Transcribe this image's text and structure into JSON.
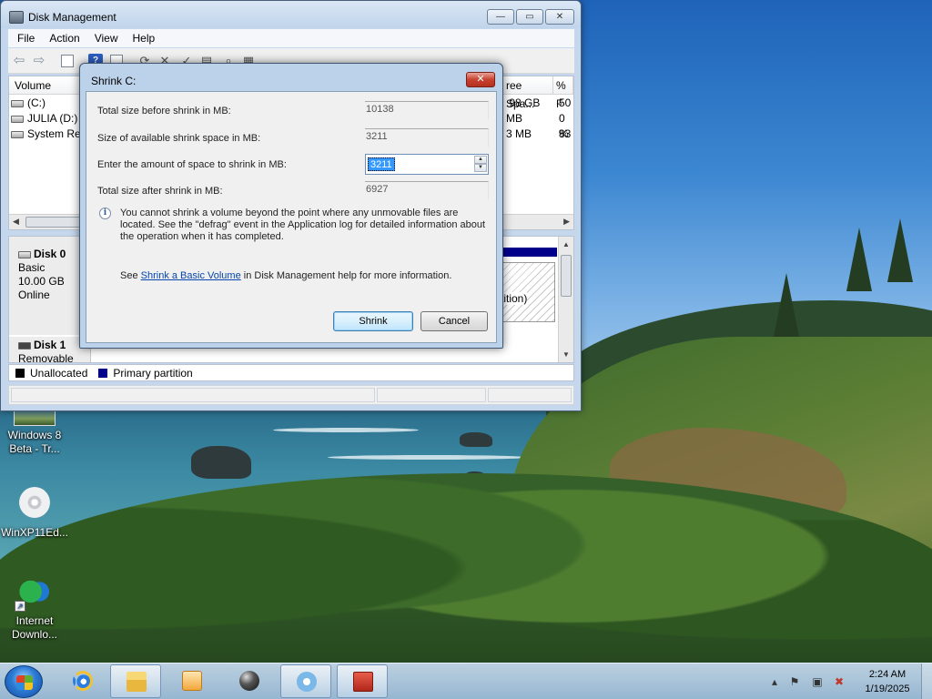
{
  "desktop": {
    "icons": [
      {
        "label": "Windows 8\nBeta - Tr...",
        "icon": "photo-thumbnail-icon"
      },
      {
        "label": "WinXP11Ed...",
        "icon": "disc-image-icon"
      },
      {
        "label": "Internet\nDownlo...",
        "icon": "internet-download-manager-icon"
      }
    ]
  },
  "disk_management": {
    "title": "Disk Management",
    "menu": [
      "File",
      "Action",
      "View",
      "Help"
    ],
    "caption_buttons": {
      "minimize": "—",
      "maximize": "▭",
      "close": "✕"
    },
    "columns": [
      "Volume",
      "ree Spa...",
      "% F"
    ],
    "volumes": [
      {
        "name": "(C:)",
        "free": ".98 GB",
        "pct": "50"
      },
      {
        "name": "JULIA (D:)",
        "free": "MB",
        "pct": "0 %"
      },
      {
        "name": "System Res",
        "free": "3 MB",
        "pct": "83"
      }
    ],
    "disks": [
      {
        "name": "Disk 0",
        "type": "Basic",
        "size": "10.00 GB",
        "status": "Online"
      },
      {
        "name": "Disk 1",
        "type": "Removable (E:)"
      }
    ],
    "partition_fragment": "tition)",
    "legend": [
      {
        "label": "Unallocated",
        "color": "#000000"
      },
      {
        "label": "Primary partition",
        "color": "#00008b"
      }
    ]
  },
  "shrink_dialog": {
    "title": "Shrink C:",
    "close_label": "✕",
    "fields": {
      "total_before": {
        "label": "Total size before shrink in MB:",
        "value": "10138"
      },
      "available": {
        "label": "Size of available shrink space in MB:",
        "value": "3211"
      },
      "amount": {
        "label": "Enter the amount of space to shrink in MB:",
        "value": "3211"
      },
      "total_after": {
        "label": "Total size after shrink in MB:",
        "value": "6927"
      }
    },
    "info": "You cannot shrink a volume beyond the point where any unmovable files are located. See the \"defrag\" event in the Application log for detailed information about the operation when it has completed.",
    "see_prefix": "See ",
    "see_link": "Shrink a Basic Volume",
    "see_suffix": " in Disk Management help for more information.",
    "buttons": {
      "shrink": "Shrink",
      "cancel": "Cancel"
    }
  },
  "taskbar": {
    "pinned": [
      {
        "name": "internet-explorer",
        "active": false
      },
      {
        "name": "windows-explorer",
        "active": true
      },
      {
        "name": "media-player",
        "active": false
      },
      {
        "name": "app-sphere",
        "active": false
      },
      {
        "name": "cleanup-tool",
        "active": true
      },
      {
        "name": "toolbox",
        "active": true
      }
    ],
    "clock": {
      "time": "2:24 AM",
      "date": "1/19/2025"
    }
  }
}
